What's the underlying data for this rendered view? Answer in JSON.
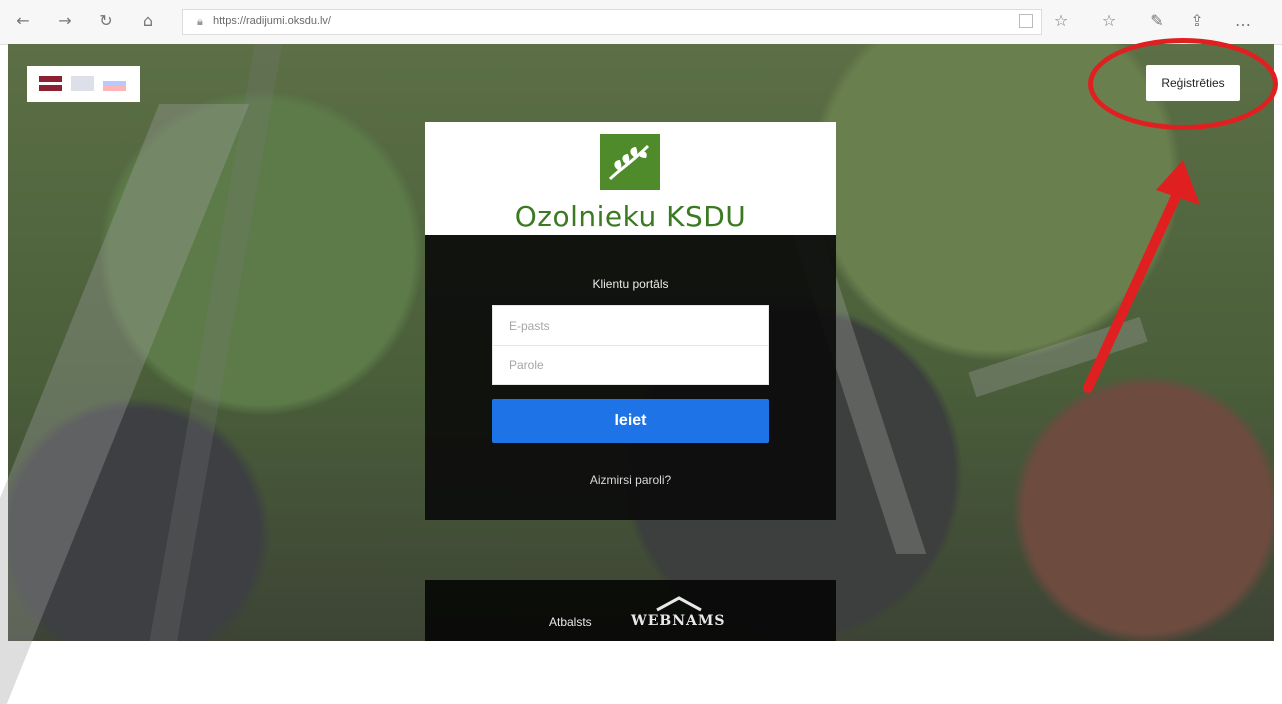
{
  "browser": {
    "address_bar": {
      "url": "https://radijumi.oksdu.lv/"
    },
    "icons": [
      "back-icon",
      "forward-icon",
      "refresh-icon",
      "home-icon",
      "lock-icon",
      "reader-mode-icon",
      "star-icon",
      "favorites-icon",
      "pen-icon",
      "share-icon",
      "more-icon"
    ]
  },
  "language_selector": {
    "flags": [
      {
        "name": "latvian-flag",
        "selected": true
      },
      {
        "name": "english-flag",
        "selected": false
      },
      {
        "name": "russian-flag",
        "selected": false
      }
    ]
  },
  "header": {
    "register_button": "Reģistrēties"
  },
  "login": {
    "brand": "Ozolnieku KSDU",
    "portal_title": "Klientu portāls",
    "email_placeholder": "E-pasts",
    "password_placeholder": "Parole",
    "submit_label": "Ieiet",
    "forgot_password": "Aizmirsi paroli?"
  },
  "footer": {
    "support_label": "Atbalsts",
    "webnams_logo": "WEBNAMS"
  },
  "annotation": {
    "color": "#e02020"
  },
  "colors": {
    "brand_green": "#3b7a22",
    "button_blue": "#1e73e6"
  }
}
